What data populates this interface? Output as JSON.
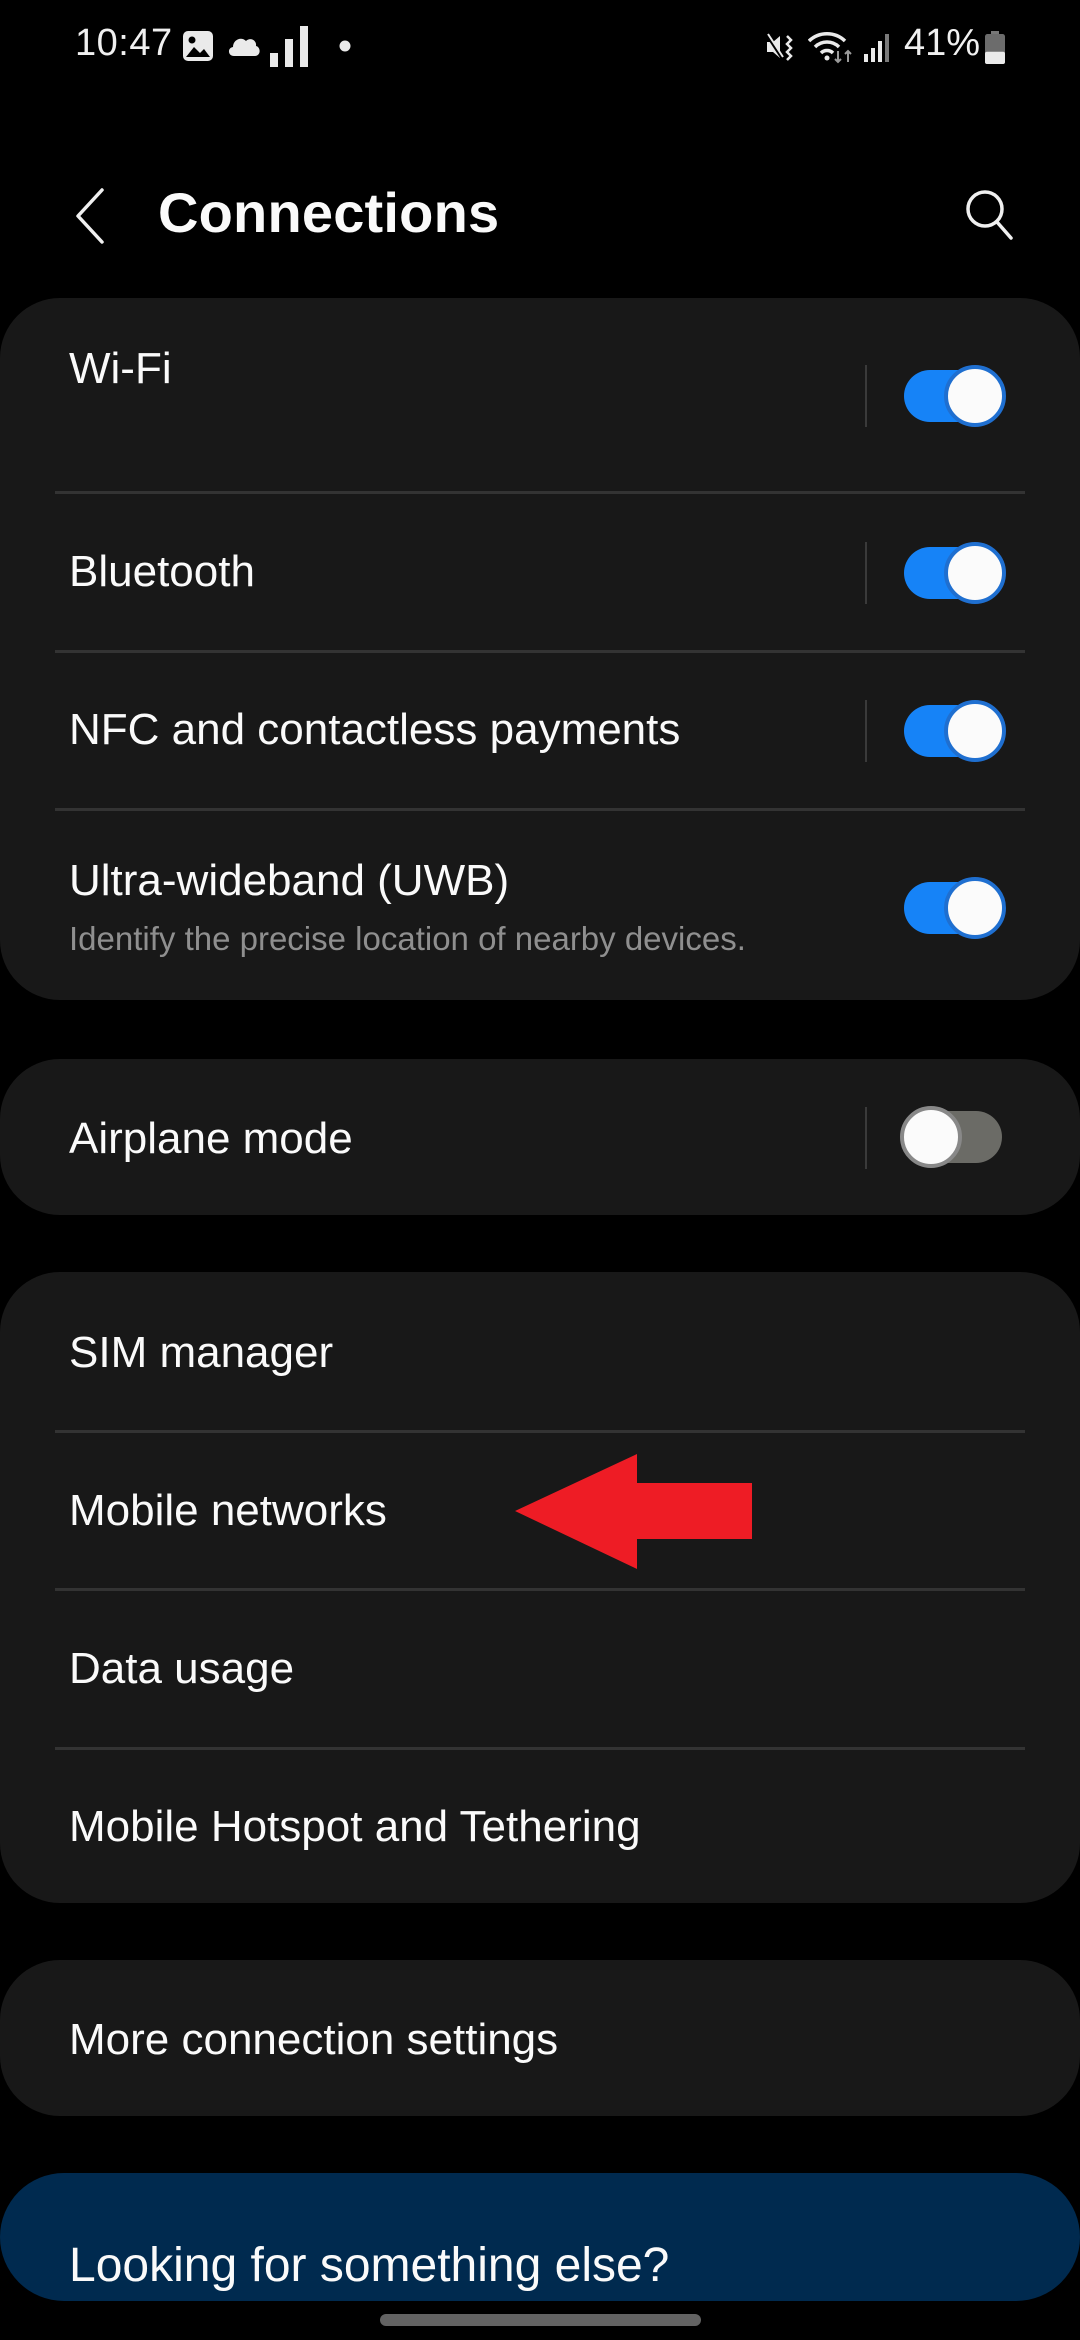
{
  "status_bar": {
    "time": "10:47",
    "left_icons": [
      "gallery-notification-icon",
      "cloud-icon",
      "signal-bars-icon",
      "notification-dot-icon"
    ],
    "right_icons": [
      "vibrate-mute-icon",
      "wifi-data-icon",
      "cellular-signal-icon",
      "battery-icon"
    ],
    "battery_percent": "41%",
    "battery_level": 0.41
  },
  "header": {
    "title": "Connections",
    "back_icon": "chevron-left-icon",
    "search_icon": "search-icon"
  },
  "groups": [
    {
      "items": [
        {
          "label": "Wi-Fi",
          "toggle": true,
          "on": true
        },
        {
          "label": "Bluetooth",
          "toggle": true,
          "on": true
        },
        {
          "label": "NFC and contactless payments",
          "toggle": true,
          "on": true
        },
        {
          "label": "Ultra-wideband (UWB)",
          "subtitle": "Identify the precise location of nearby devices.",
          "toggle": true,
          "on": true
        }
      ]
    },
    {
      "items": [
        {
          "label": "Airplane mode",
          "toggle": true,
          "on": false
        }
      ]
    },
    {
      "items": [
        {
          "label": "SIM manager"
        },
        {
          "label": "Mobile networks"
        },
        {
          "label": "Data usage"
        },
        {
          "label": "Mobile Hotspot and Tethering"
        }
      ]
    },
    {
      "items": [
        {
          "label": "More connection settings"
        }
      ]
    }
  ],
  "suggestion_card": {
    "label": "Looking for something else?"
  },
  "annotation": {
    "type": "red-arrow",
    "points_to": "Mobile networks",
    "color": "#ee1c25"
  },
  "colors": {
    "background": "#000000",
    "card": "#181818",
    "toggle_on": "#1683f7",
    "toggle_off": "#6b6b66",
    "suggestion_card": "#002a4f",
    "subtitle_text": "#8f8f8f"
  }
}
